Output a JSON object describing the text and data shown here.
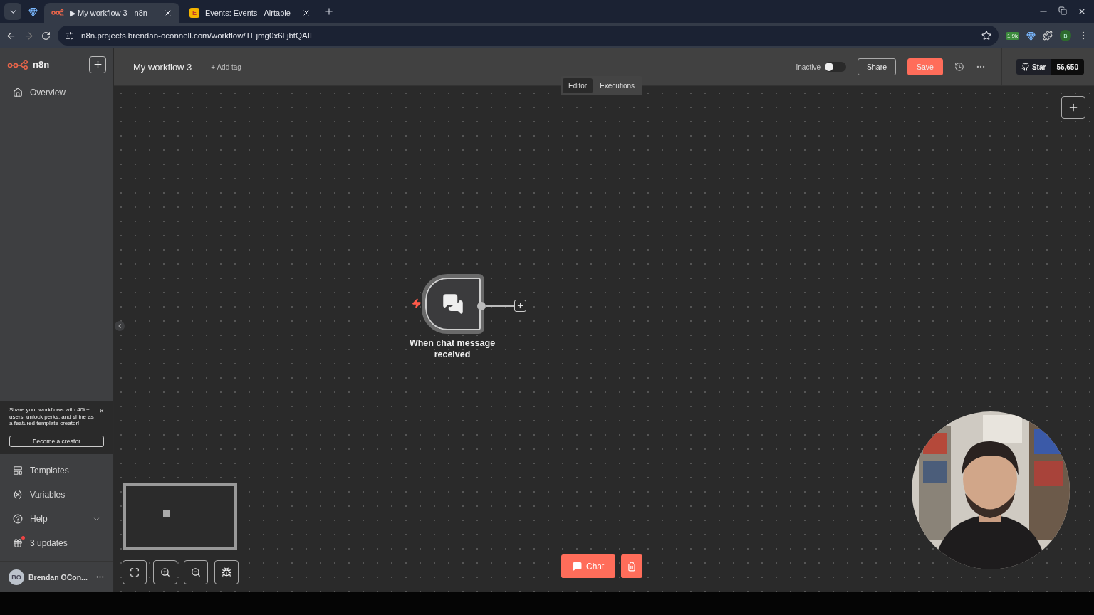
{
  "browser": {
    "tabs": [
      {
        "title": "▶ My workflow 3 - n8n",
        "selected": true
      },
      {
        "title": "Events: Events - Airtable",
        "selected": false
      }
    ],
    "favicon_text": "E",
    "url": "n8n.projects.brendan-oconnell.com/workflow/TEjmg0x6LjbtQAIF",
    "extension_badge": "1.9k",
    "profile_initial": "B"
  },
  "sidebar": {
    "logo": "n8n",
    "items": [
      {
        "label": "Overview",
        "kind": "home"
      }
    ],
    "promo": {
      "text": "Share your workflows with 40k+ users, unlock perks, and shine as a featured template creator!",
      "close": "×",
      "button": "Become a creator"
    },
    "bottom_items": [
      {
        "label": "Templates",
        "kind": "templates"
      },
      {
        "label": "Variables",
        "kind": "variables"
      },
      {
        "label": "Help",
        "kind": "help"
      },
      {
        "label": "3 updates",
        "kind": "updates"
      }
    ],
    "user": {
      "initials": "BO",
      "name": "Brendan OCon..."
    }
  },
  "header": {
    "title": "My workflow 3",
    "add_tag": "+ Add tag",
    "status": "Inactive",
    "active": false,
    "share": "Share",
    "save": "Save",
    "star": "Star",
    "star_count": "56,650"
  },
  "view_tabs": [
    {
      "label": "Editor",
      "selected": true
    },
    {
      "label": "Executions",
      "selected": false
    }
  ],
  "canvas": {
    "node": {
      "label": "When chat message received"
    },
    "chat_button": "Chat"
  }
}
